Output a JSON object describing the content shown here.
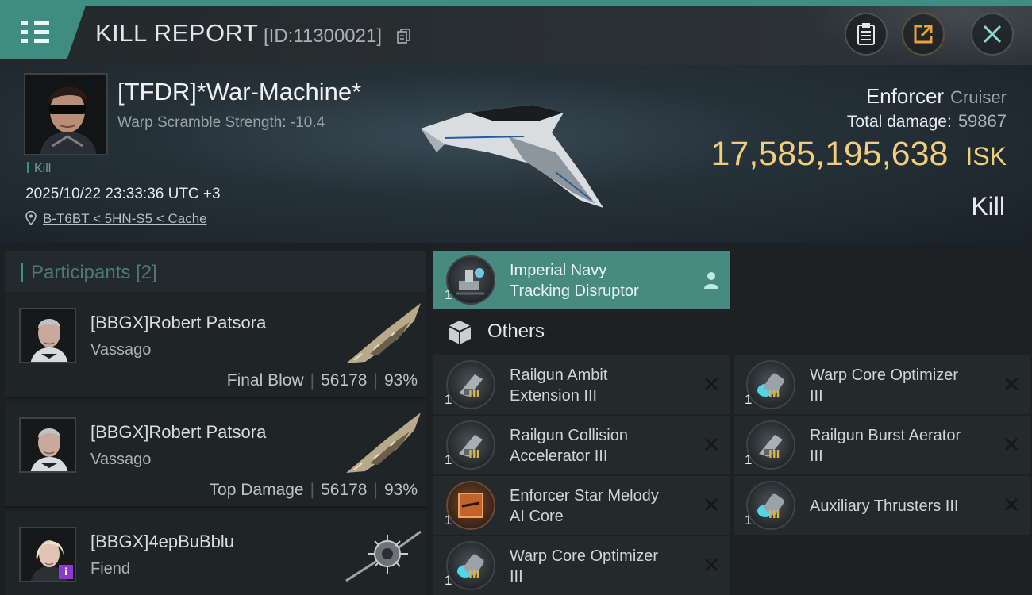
{
  "header": {
    "title": "KILL REPORT",
    "report_id": "[ID:11300021]"
  },
  "victim": {
    "name": "[TFDR]*War-Machine*",
    "warp_scramble": "Warp Scramble Strength: -10.4",
    "tag": "Kill",
    "datetime": "2025/10/22 23:33:36 UTC +3",
    "location": "B-T6BT < 5HN-S5 < Cache",
    "ship_name": "Enforcer",
    "ship_class": "Cruiser",
    "total_damage_label": "Total damage:",
    "total_damage": "59867",
    "isk_value": "17,585,195,638",
    "isk_unit": "ISK",
    "result": "Kill"
  },
  "participants": {
    "header_label": "Participants",
    "count": "[2]",
    "list": [
      {
        "name": "[BBGX]Robert Patsora",
        "ship": "Vassago",
        "role": "Final Blow",
        "damage": "56178",
        "percent": "93%"
      },
      {
        "name": "[BBGX]Robert Patsora",
        "ship": "Vassago",
        "role": "Top Damage",
        "damage": "56178",
        "percent": "93%"
      },
      {
        "name": "[BBGX]4epBuBblu",
        "ship": "Fiend"
      }
    ]
  },
  "items": {
    "highlighted": {
      "qty": "1",
      "name_line1": "Imperial Navy",
      "name_line2": "Tracking Disruptor"
    },
    "others_label": "Others",
    "list": [
      {
        "qty": "1",
        "name_line1": "Railgun Ambit",
        "name_line2": "Extension III",
        "tier": "III"
      },
      {
        "qty": "1",
        "name_line1": "Warp Core Optimizer",
        "name_line2": "III",
        "tier": "III"
      },
      {
        "qty": "1",
        "name_line1": "Railgun Collision",
        "name_line2": "Accelerator III",
        "tier": "III"
      },
      {
        "qty": "1",
        "name_line1": "Railgun Burst Aerator",
        "name_line2": "III",
        "tier": "III"
      },
      {
        "qty": "1",
        "name_line1": "Enforcer Star Melody",
        "name_line2": "AI Core",
        "tier": ""
      },
      {
        "qty": "1",
        "name_line1": "Auxiliary Thrusters III",
        "name_line2": "",
        "tier": "III"
      },
      {
        "qty": "1",
        "name_line1": "Warp Core Optimizer",
        "name_line2": "III",
        "tier": "III"
      }
    ]
  },
  "colors": {
    "accent": "#3e8e83",
    "isk": "#f2cd7a",
    "highlight_item": "#478a7f"
  }
}
